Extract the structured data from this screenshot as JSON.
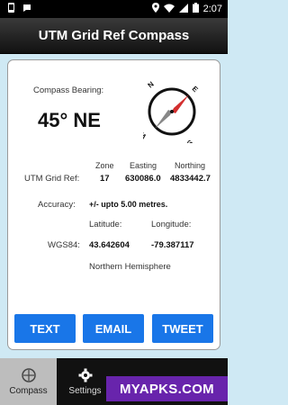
{
  "status_bar": {
    "time": "2:07"
  },
  "app": {
    "title": "UTM Grid Ref Compass"
  },
  "compass": {
    "bearing_label": "Compass Bearing:",
    "bearing_value": "45° NE",
    "direction_letters": {
      "n": "N",
      "e": "E",
      "s": "S",
      "w": "W"
    }
  },
  "utm": {
    "label": "UTM Grid Ref:",
    "headers": {
      "zone": "Zone",
      "easting": "Easting",
      "northing": "Northing"
    },
    "zone": "17",
    "easting": "630086.0",
    "northing": "4833442.7"
  },
  "accuracy": {
    "label": "Accuracy:",
    "value": "+/- upto 5.00 metres."
  },
  "wgs84": {
    "label": "WGS84:",
    "latitude_label": "Latitude:",
    "longitude_label": "Longitude:",
    "latitude": "43.642604",
    "longitude": "-79.387117",
    "hemisphere": "Northern Hemisphere"
  },
  "buttons": {
    "text": "TEXT",
    "email": "EMAIL",
    "tweet": "TWEET"
  },
  "tabs": [
    {
      "label": "Compass",
      "icon": "compass-icon",
      "active": true
    },
    {
      "label": "Settings",
      "icon": "gear-icon",
      "active": false
    }
  ],
  "watermark": "MYAPKS.COM",
  "colors": {
    "accent": "#1976e8",
    "background": "#cfe9f4",
    "needle_north": "#d32f2f"
  }
}
